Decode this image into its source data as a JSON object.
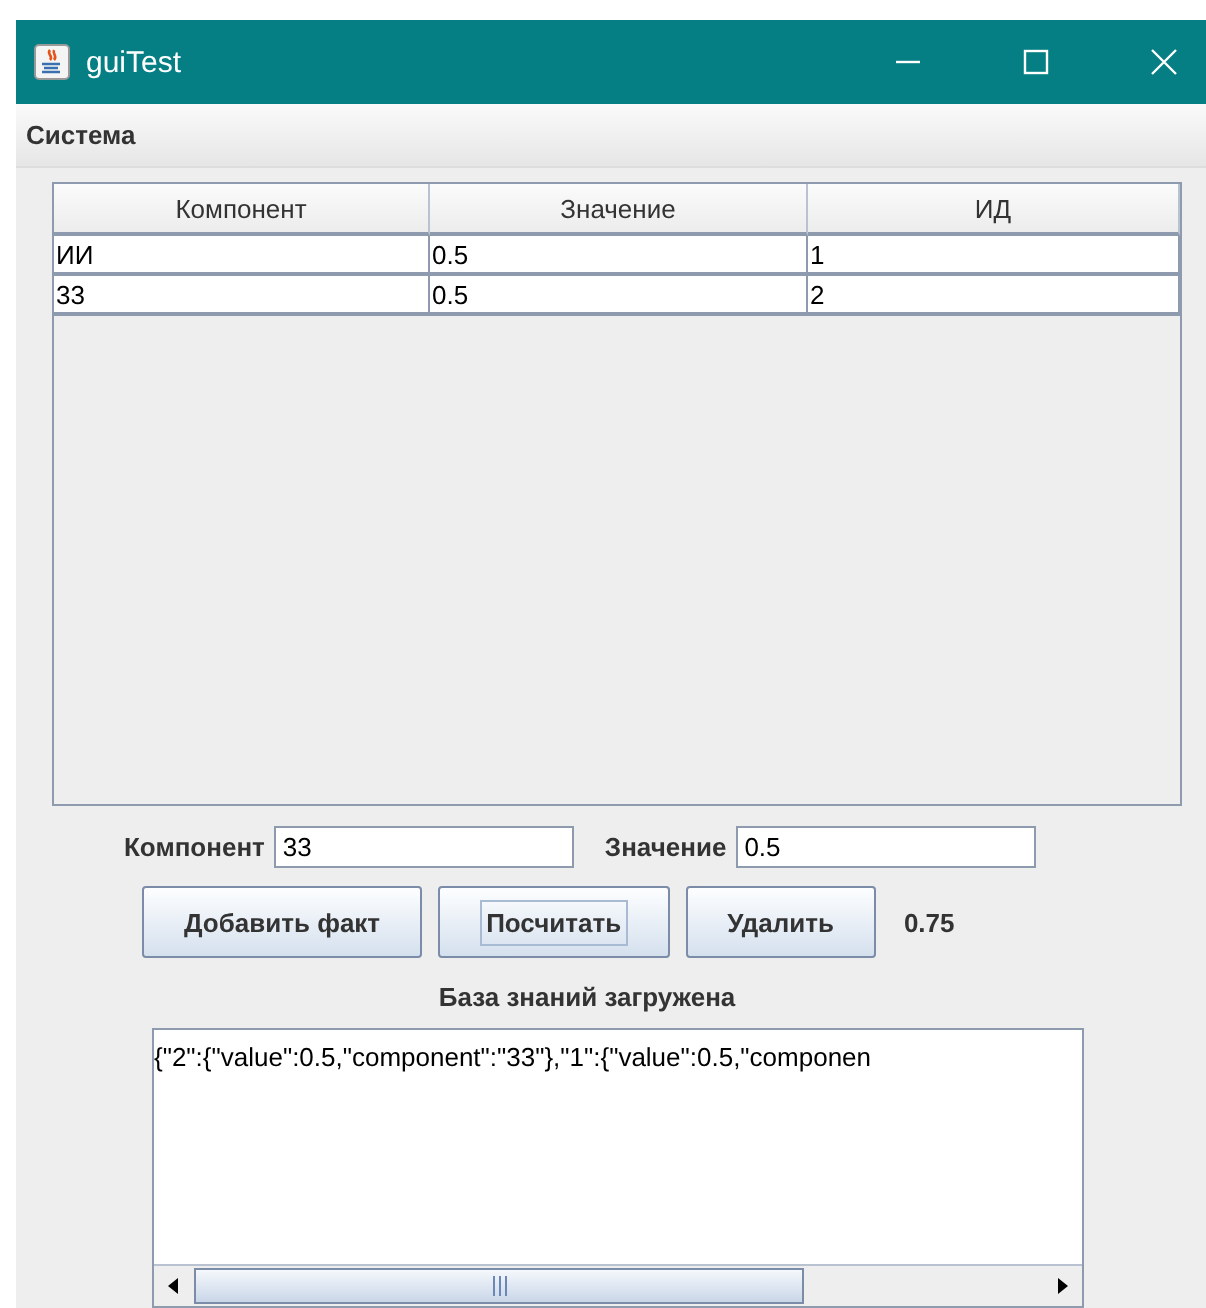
{
  "window": {
    "title": "guiTest"
  },
  "menu": [
    {
      "label": "Система"
    }
  ],
  "table": {
    "columns": [
      "Компонент",
      "Значение",
      "ИД"
    ],
    "rows": [
      [
        "ИИ",
        "0.5",
        "1"
      ],
      [
        "33",
        "0.5",
        "2"
      ]
    ]
  },
  "form": {
    "fields": [
      {
        "label": "Компонент",
        "value": "33"
      },
      {
        "label": "Значение",
        "value": "0.5"
      }
    ]
  },
  "buttons": [
    {
      "label": "Добавить факт",
      "focused": false
    },
    {
      "label": "Посчитать",
      "focused": true
    },
    {
      "label": "Удалить",
      "focused": false
    }
  ],
  "result": "0.75",
  "status": "База знаний загружена",
  "output": "{\"2\":{\"value\":0.5,\"component\":\"33\"},\"1\":{\"value\":0.5,\"componen"
}
